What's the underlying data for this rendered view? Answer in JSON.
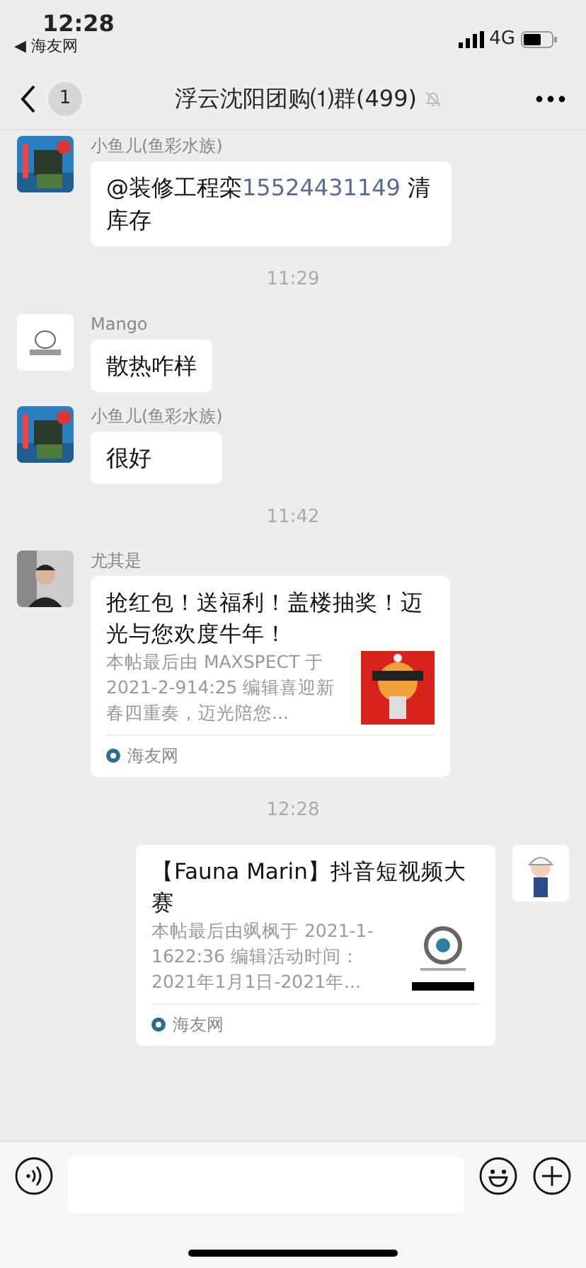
{
  "status_bar": {
    "time": "12:28",
    "back_app": "◀ 海友网",
    "network": "4G"
  },
  "header": {
    "back_badge": "1",
    "title": "浮云沈阳团购⑴群(499)",
    "muted": true
  },
  "messages": [
    {
      "kind": "text",
      "from_me": false,
      "sender": "小鱼儿(鱼彩水族)",
      "parts": [
        {
          "kind": "plain",
          "text": "@装修工程栾"
        },
        {
          "kind": "link",
          "text": "15524431149"
        },
        {
          "kind": "plain",
          "text": " 清库存"
        }
      ]
    },
    {
      "kind": "time",
      "text": "11:29"
    },
    {
      "kind": "text",
      "from_me": false,
      "sender": "Mango",
      "parts": [
        {
          "kind": "plain",
          "text": "散热咋样"
        }
      ]
    },
    {
      "kind": "text",
      "from_me": false,
      "sender": "小鱼儿(鱼彩水族)",
      "parts": [
        {
          "kind": "plain",
          "text": "很好"
        }
      ]
    },
    {
      "kind": "time",
      "text": "11:42"
    },
    {
      "kind": "card",
      "from_me": false,
      "sender": "尤其是",
      "title": "抢红包！送福利！盖楼抽奖！迈光与您欢度牛年！",
      "description": "本帖最后由 MAXSPECT 于 2021-2-914:25 编辑喜迎新春四重奏，迈光陪您...",
      "source": "海友网"
    },
    {
      "kind": "time",
      "text": "12:28"
    },
    {
      "kind": "card",
      "from_me": true,
      "title": "【Fauna Marin】抖音短视频大赛",
      "description": "本帖最后由飒枫于 2021-1-1622:36 编辑活动时间：2021年1月1日-2021年...",
      "source": "海友网"
    }
  ]
}
